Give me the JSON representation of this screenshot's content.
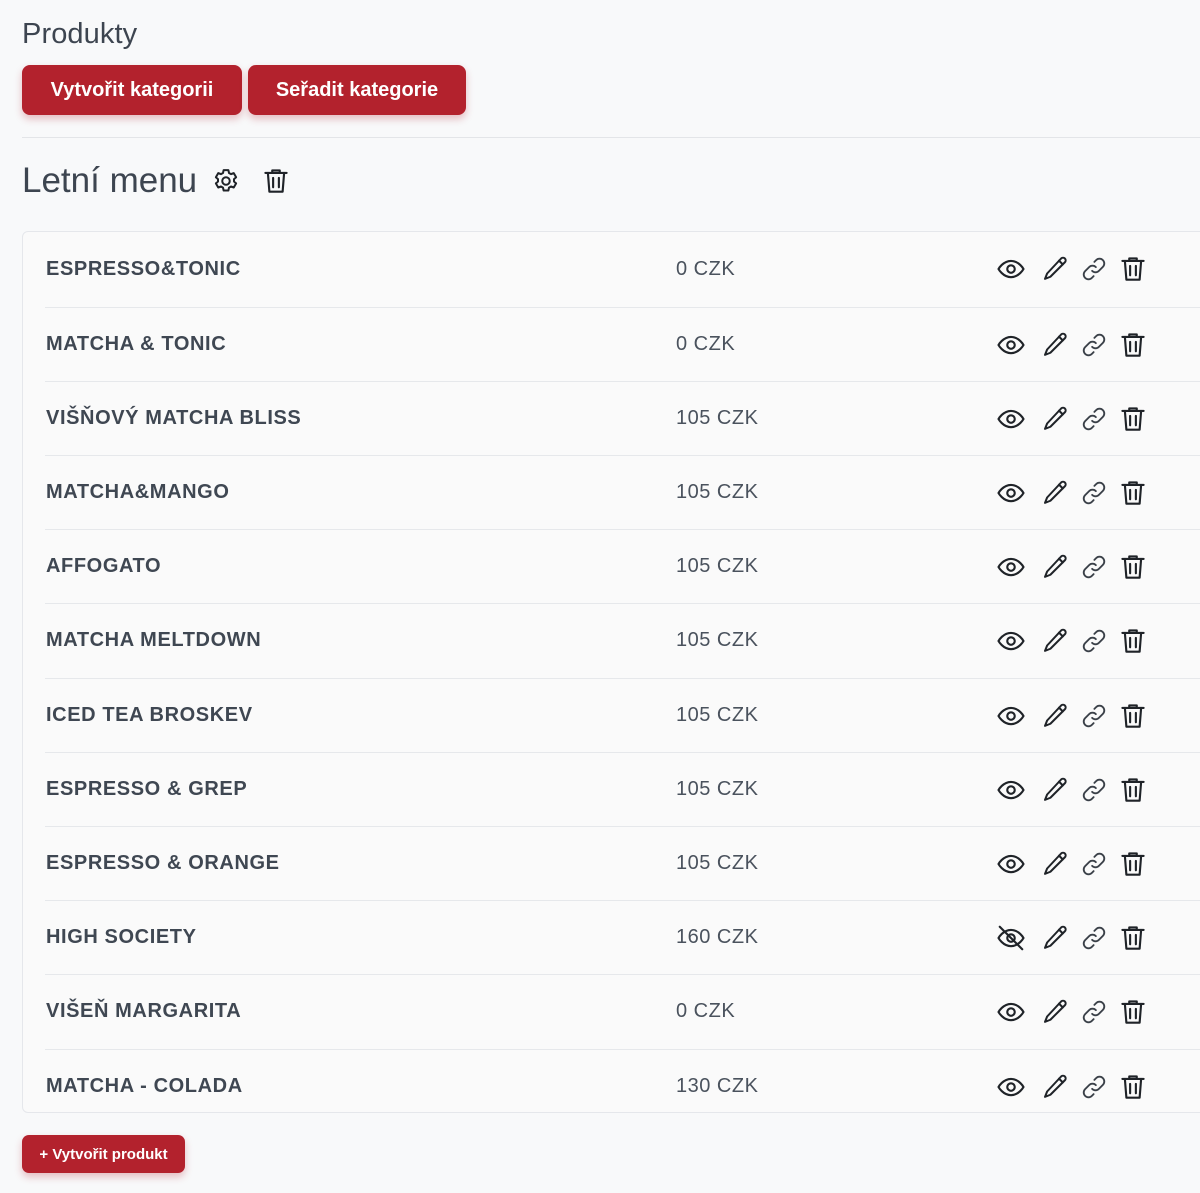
{
  "page": {
    "title": "Produkty"
  },
  "toolbar": {
    "create_category_label": "Vytvořit kategorii",
    "sort_categories_label": "Seřadit kategorie"
  },
  "category": {
    "title": "Letní menu",
    "icons": [
      "gear-icon",
      "trash-icon"
    ]
  },
  "products": [
    {
      "name": "ESPRESSO&TONIC",
      "price": "0 CZK",
      "visible": true
    },
    {
      "name": "MATCHA & TONIC",
      "price": "0 CZK",
      "visible": true
    },
    {
      "name": "VIŠŇOVÝ MATCHA BLISS",
      "price": "105 CZK",
      "visible": true
    },
    {
      "name": "MATCHA&MANGO",
      "price": "105 CZK",
      "visible": true
    },
    {
      "name": "AFFOGATO",
      "price": "105 CZK",
      "visible": true
    },
    {
      "name": "MATCHA MELTDOWN",
      "price": "105 CZK",
      "visible": true
    },
    {
      "name": "ICED TEA BROSKEV",
      "price": "105 CZK",
      "visible": true
    },
    {
      "name": "ESPRESSO & GREP",
      "price": "105 CZK",
      "visible": true
    },
    {
      "name": "ESPRESSO & ORANGE",
      "price": "105 CZK",
      "visible": true
    },
    {
      "name": "HIGH SOCIETY",
      "price": "160 CZK",
      "visible": false
    },
    {
      "name": "VIŠEŇ MARGARITA",
      "price": "0 CZK",
      "visible": true
    },
    {
      "name": "MATCHA - COLADA",
      "price": "130 CZK",
      "visible": true
    }
  ],
  "row_action_icons": [
    "eye-icon",
    "pencil-icon",
    "link-icon",
    "trash-icon"
  ],
  "footer": {
    "create_product_label": "+ Vytvořit produkt"
  },
  "colors": {
    "accent": "#b3222d",
    "text": "#3d4550",
    "background": "#f8f9fa"
  }
}
